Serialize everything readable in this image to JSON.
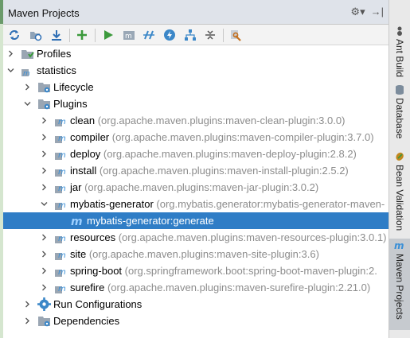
{
  "panel": {
    "title": "Maven Projects"
  },
  "title_actions": {
    "settings_icon": "gear-icon",
    "hide_icon": "pin-right-icon"
  },
  "toolbar": {
    "buttons": [
      {
        "name": "reimport-button",
        "icon": "refresh-icon"
      },
      {
        "name": "generate-sources-button",
        "icon": "folder-refresh-icon"
      },
      {
        "name": "download-sources-button",
        "icon": "download-icon"
      },
      {
        "name": "add-project-button",
        "icon": "plus-icon"
      },
      {
        "name": "run-goal-button",
        "icon": "play-icon"
      },
      {
        "name": "execute-maven-goal-button",
        "icon": "m-goal-icon"
      },
      {
        "name": "toggle-offline-button",
        "icon": "offline-icon"
      },
      {
        "name": "skip-tests-button",
        "icon": "lightning-icon"
      },
      {
        "name": "show-dependencies-button",
        "icon": "diagram-icon"
      },
      {
        "name": "collapse-all-button",
        "icon": "collapse-icon"
      },
      {
        "name": "maven-settings-button",
        "icon": "wrench-icon"
      }
    ]
  },
  "tree": [
    {
      "id": "profiles",
      "label": "Profiles",
      "coord": "",
      "level": 0,
      "expanded": false,
      "icon": "profiles-icon"
    },
    {
      "id": "statistics",
      "label": "statistics",
      "coord": "",
      "level": 0,
      "expanded": true,
      "icon": "maven-project-icon"
    },
    {
      "id": "lifecycle",
      "label": "Lifecycle",
      "coord": "",
      "level": 1,
      "expanded": false,
      "icon": "folder-gear-icon"
    },
    {
      "id": "plugins",
      "label": "Plugins",
      "coord": "",
      "level": 1,
      "expanded": true,
      "icon": "folder-gear-icon"
    },
    {
      "id": "clean",
      "label": "clean",
      "coord": "(org.apache.maven.plugins:maven-clean-plugin:3.0.0)",
      "level": 2,
      "expanded": false,
      "icon": "maven-plugin-icon"
    },
    {
      "id": "compiler",
      "label": "compiler",
      "coord": "(org.apache.maven.plugins:maven-compiler-plugin:3.7.0)",
      "level": 2,
      "expanded": false,
      "icon": "maven-plugin-icon"
    },
    {
      "id": "deploy",
      "label": "deploy",
      "coord": "(org.apache.maven.plugins:maven-deploy-plugin:2.8.2)",
      "level": 2,
      "expanded": false,
      "icon": "maven-plugin-icon"
    },
    {
      "id": "install",
      "label": "install",
      "coord": "(org.apache.maven.plugins:maven-install-plugin:2.5.2)",
      "level": 2,
      "expanded": false,
      "icon": "maven-plugin-icon"
    },
    {
      "id": "jar",
      "label": "jar",
      "coord": "(org.apache.maven.plugins:maven-jar-plugin:3.0.2)",
      "level": 2,
      "expanded": false,
      "icon": "maven-plugin-icon"
    },
    {
      "id": "mybatis-generator",
      "label": "mybatis-generator",
      "coord": "(org.mybatis.generator:mybatis-generator-maven-",
      "level": 2,
      "expanded": true,
      "icon": "maven-plugin-icon"
    },
    {
      "id": "mybatis-generator-generate",
      "label": "mybatis-generator:generate",
      "coord": "",
      "level": 3,
      "expanded": null,
      "icon": "maven-goal-icon",
      "selected": true
    },
    {
      "id": "resources",
      "label": "resources",
      "coord": "(org.apache.maven.plugins:maven-resources-plugin:3.0.1)",
      "level": 2,
      "expanded": false,
      "icon": "maven-plugin-icon"
    },
    {
      "id": "site",
      "label": "site",
      "coord": "(org.apache.maven.plugins:maven-site-plugin:3.6)",
      "level": 2,
      "expanded": false,
      "icon": "maven-plugin-icon"
    },
    {
      "id": "spring-boot",
      "label": "spring-boot",
      "coord": "(org.springframework.boot:spring-boot-maven-plugin:2.",
      "level": 2,
      "expanded": false,
      "icon": "maven-plugin-icon"
    },
    {
      "id": "surefire",
      "label": "surefire",
      "coord": "(org.apache.maven.plugins:maven-surefire-plugin:2.21.0)",
      "level": 2,
      "expanded": false,
      "icon": "maven-plugin-icon"
    },
    {
      "id": "run-configurations",
      "label": "Run Configurations",
      "coord": "",
      "level": 1,
      "expanded": false,
      "icon": "gear-icon"
    },
    {
      "id": "dependencies",
      "label": "Dependencies",
      "coord": "",
      "level": 1,
      "expanded": false,
      "icon": "folder-gear-icon"
    }
  ],
  "sidebar": {
    "tabs": [
      {
        "id": "ant-build",
        "label": "Ant Build",
        "icon": "ant-icon",
        "active": false
      },
      {
        "id": "database",
        "label": "Database",
        "icon": "database-icon",
        "active": false
      },
      {
        "id": "bean-validation",
        "label": "Bean Validation",
        "icon": "bean-icon",
        "active": false
      },
      {
        "id": "maven-projects",
        "label": "Maven Projects",
        "icon": "maven-m-icon",
        "active": true
      }
    ]
  },
  "colors": {
    "selection": "#2f7dc6",
    "coordinates_text": "#8c8c8c",
    "title_bar": "#dfe3ea",
    "maven_blue": "#3a8fd6",
    "gear_blue": "#3b87c8"
  }
}
